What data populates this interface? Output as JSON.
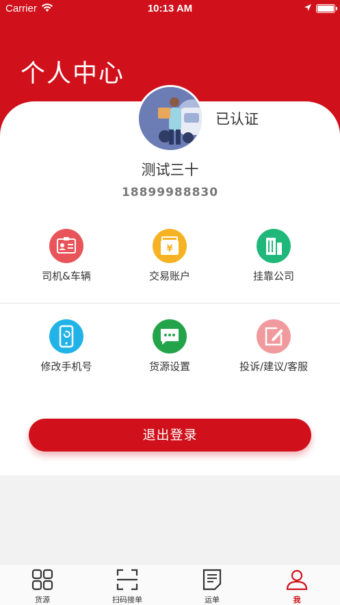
{
  "status_bar": {
    "carrier": "Carrier",
    "time": "10:13 AM"
  },
  "page": {
    "title": "个人中心"
  },
  "profile": {
    "verified_label": "已认证",
    "name": "测试三十",
    "phone": "18899988830"
  },
  "menu": [
    {
      "label": "司机&车辆",
      "icon": "id-card-icon",
      "color": "#e8545a"
    },
    {
      "label": "交易账户",
      "icon": "wallet-icon",
      "color": "#f5b323"
    },
    {
      "label": "挂靠公司",
      "icon": "building-icon",
      "color": "#20b87a"
    },
    {
      "label": "修改手机号",
      "icon": "phone-icon",
      "color": "#21b3e8"
    },
    {
      "label": "货源设置",
      "icon": "chat-icon",
      "color": "#24a44a"
    },
    {
      "label": "投诉/建议/客服",
      "icon": "edit-icon",
      "color": "#f09a9d"
    }
  ],
  "actions": {
    "logout_label": "退出登录"
  },
  "tabbar": [
    {
      "label": "货源",
      "icon": "grid-icon",
      "active": false
    },
    {
      "label": "扫码接单",
      "icon": "scan-icon",
      "active": false
    },
    {
      "label": "运单",
      "icon": "document-icon",
      "active": false
    },
    {
      "label": "我",
      "icon": "user-icon",
      "active": true
    }
  ],
  "colors": {
    "brand": "#d0101b",
    "background": "#f2f2f2"
  }
}
